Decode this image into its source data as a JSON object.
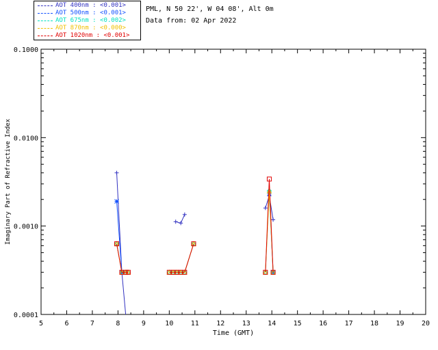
{
  "header": {
    "station": "PML, N 50 22', W 04 08', Alt 0m",
    "date_line": "Data from: 02 Apr 2022"
  },
  "legend": [
    {
      "label": "AOT  400nm : <0.001>",
      "color": "#3030c0"
    },
    {
      "label": "AOT  500nm : <0.001>",
      "color": "#1050ff"
    },
    {
      "label": "AOT  675nm : <0.002>",
      "color": "#00e0c0"
    },
    {
      "label": "AOT  870nm : <0.000>",
      "color": "#f0c000"
    },
    {
      "label": "AOT 1020nm : <0.001>",
      "color": "#e00000"
    }
  ],
  "chart_data": {
    "type": "scatter",
    "xlabel": "Time (GMT)",
    "ylabel": "Imaginary Part of Refractive Index",
    "xlim": [
      5,
      20
    ],
    "ylim": [
      0.0001,
      0.1
    ],
    "yscale": "log",
    "xticks": [
      "5",
      "6",
      "7",
      "8",
      "9",
      "10",
      "11",
      "12",
      "13",
      "14",
      "15",
      "16",
      "17",
      "18",
      "19",
      "20"
    ],
    "yticks": [
      "0.0001",
      "0.0010",
      "0.0100",
      "0.1000"
    ],
    "grid": false,
    "series": [
      {
        "name": "AOT  400nm : <0.001>",
        "color": "#3030c0",
        "marker": "plus",
        "points": [
          [
            7.95,
            0.004
          ],
          [
            8.15,
            0.0003
          ],
          [
            8.3,
            7e-05
          ],
          [
            10.25,
            0.00112
          ],
          [
            10.45,
            0.00108
          ],
          [
            10.6,
            0.00135
          ],
          [
            13.75,
            0.0016
          ],
          [
            13.9,
            0.0022
          ],
          [
            14.05,
            0.00118
          ]
        ]
      },
      {
        "name": "AOT  500nm : <0.001>",
        "color": "#1050ff",
        "marker": "star",
        "points": [
          [
            7.95,
            0.0019
          ],
          [
            8.15,
            0.0003
          ],
          [
            13.9,
            0.0023
          ],
          [
            14.05,
            0.0003
          ]
        ]
      },
      {
        "name": "AOT  675nm : <0.002>",
        "color": "#00e0c0",
        "marker": "diamond",
        "points": [
          [
            7.95,
            0.00063
          ],
          [
            8.15,
            0.0003
          ],
          [
            8.3,
            0.0003
          ],
          [
            8.4,
            0.0003
          ],
          [
            10.0,
            0.0003
          ],
          [
            10.15,
            0.0003
          ],
          [
            10.3,
            0.0003
          ],
          [
            10.45,
            0.0003
          ],
          [
            10.6,
            0.0003
          ],
          [
            10.95,
            0.00063
          ],
          [
            13.75,
            0.0003
          ],
          [
            13.9,
            0.0025
          ],
          [
            14.05,
            0.0003
          ]
        ]
      },
      {
        "name": "AOT  870nm : <0.000>",
        "color": "#f0c000",
        "marker": "triangle",
        "points": [
          [
            7.95,
            0.00063
          ],
          [
            8.15,
            0.0003
          ],
          [
            8.3,
            0.0003
          ],
          [
            8.4,
            0.0003
          ],
          [
            10.0,
            0.0003
          ],
          [
            10.15,
            0.0003
          ],
          [
            10.3,
            0.0003
          ],
          [
            10.45,
            0.0003
          ],
          [
            10.6,
            0.0003
          ],
          [
            10.95,
            0.00063
          ],
          [
            13.75,
            0.0003
          ],
          [
            13.9,
            0.0025
          ],
          [
            14.05,
            0.0003
          ]
        ]
      },
      {
        "name": "AOT 1020nm : <0.001>",
        "color": "#e00000",
        "marker": "square",
        "points": [
          [
            7.95,
            0.00063
          ],
          [
            8.15,
            0.0003
          ],
          [
            8.3,
            0.0003
          ],
          [
            8.4,
            0.0003
          ],
          [
            10.0,
            0.0003
          ],
          [
            10.15,
            0.0003
          ],
          [
            10.3,
            0.0003
          ],
          [
            10.45,
            0.0003
          ],
          [
            10.6,
            0.0003
          ],
          [
            10.95,
            0.00063
          ],
          [
            13.75,
            0.0003
          ],
          [
            13.9,
            0.0034
          ],
          [
            14.05,
            0.0003
          ]
        ]
      }
    ]
  }
}
